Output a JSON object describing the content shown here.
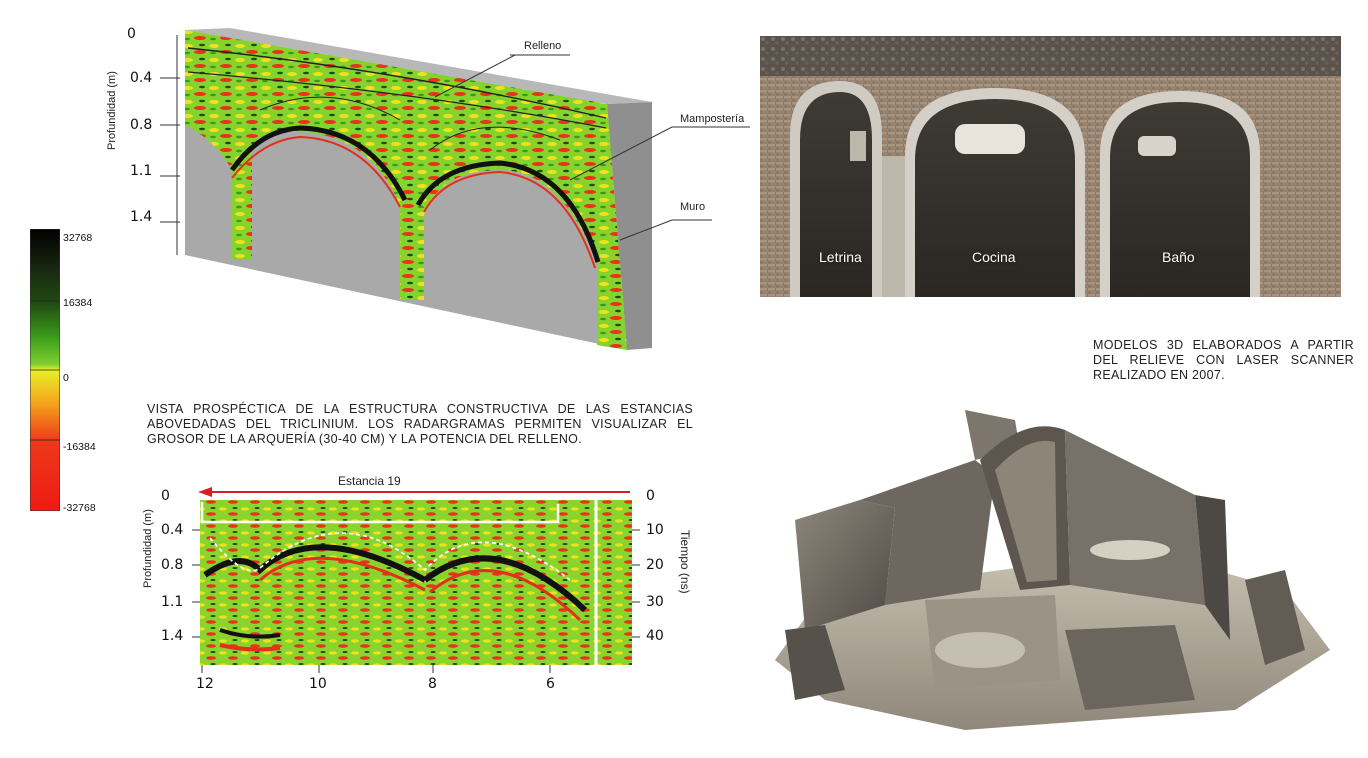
{
  "colorbar": {
    "labels": [
      "32768",
      "16384",
      "0",
      "-16384",
      "-32768"
    ]
  },
  "perspective": {
    "depth_label": "Profundidad (m)",
    "depth_ticks": [
      "0",
      "0.4",
      "0.8",
      "1.1",
      "1.4"
    ],
    "callouts": {
      "relleno": "Relleno",
      "mamposteria": "Mampostería",
      "muro": "Muro"
    }
  },
  "caption_left": "VISTA PROSPÉCTICA DE LA ESTRUCTURA CONSTRUCTIVA DE LAS ESTANCIAS ABOVEDADAS DEL TRICLINIUM. LOS RADARGRAMAS PERMITEN VISUALIZAR EL GROSOR DE LA ARQUERÍA (30-40 cm) Y LA POTENCIA DEL RELLENO.",
  "radargram": {
    "room_label": "Estancia 19",
    "depth_label": "Profundidad (m)",
    "depth_ticks": [
      "0",
      "0.4",
      "0.8",
      "1.1",
      "1.4"
    ],
    "time_label": "Tiempo (ns)",
    "time_ticks": [
      "0",
      "10",
      "20",
      "30",
      "40"
    ],
    "x_ticks": [
      "12",
      "10",
      "8",
      "6"
    ]
  },
  "photo": {
    "labels": [
      "Letrina",
      "Cocina",
      "Baño"
    ]
  },
  "caption_right": "MODELOS 3D ELABORADOS A PARTIR DEL RELIEVE CON LASER SCANNER REALIZADO EN 2007.",
  "colors": {
    "gpr_green": "#7ccf2a",
    "gpr_yellow": "#f2e21a",
    "gpr_red": "#e2301a",
    "wall_grey": "#a8a8a8",
    "arrow_red": "#d42020"
  }
}
